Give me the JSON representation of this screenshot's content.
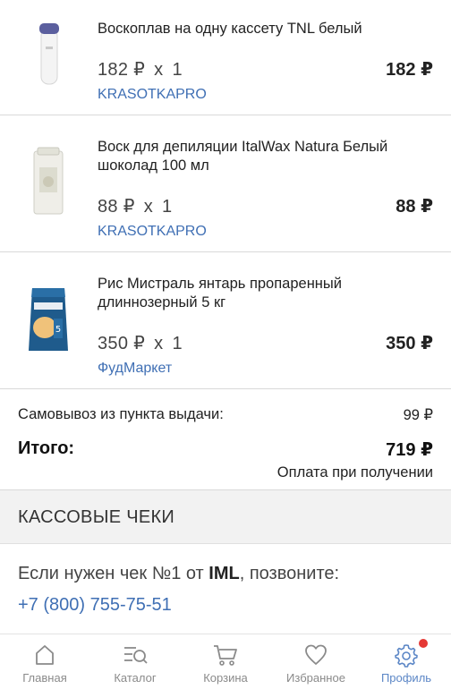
{
  "items": [
    {
      "title": "Воскоплав на одну кассету TNL белый",
      "unit_price": "182 ₽",
      "multiplier": "x",
      "quantity": "1",
      "total": "182 ₽",
      "seller": "KRASOTKAPRO"
    },
    {
      "title": "Воск для депиляции ItalWax Natura Белый шоколад 100 мл",
      "unit_price": "88 ₽",
      "multiplier": "x",
      "quantity": "1",
      "total": "88 ₽",
      "seller": "KRASOTKAPRO"
    },
    {
      "title": "Рис Мистраль янтарь пропаренный длиннозерный 5 кг",
      "unit_price": "350 ₽",
      "multiplier": "x",
      "quantity": "1",
      "total": "350 ₽",
      "seller": "ФудМаркет"
    }
  ],
  "summary": {
    "pickup_label": "Самовывоз из пункта выдачи:",
    "pickup_price": "99 ₽",
    "total_label": "Итого:",
    "total_price": "719 ₽",
    "payment_note": "Оплата при получении"
  },
  "receipts": {
    "header": "КАССОВЫЕ ЧЕКИ",
    "info_prefix": "Если нужен чек №1 от ",
    "info_company": "IML",
    "info_suffix": ", позвоните:",
    "phone": "+7 (800) 755-75-51"
  },
  "nav": {
    "items": [
      {
        "label": "Главная",
        "icon": "home-icon"
      },
      {
        "label": "Каталог",
        "icon": "catalog-search-icon"
      },
      {
        "label": "Корзина",
        "icon": "cart-icon"
      },
      {
        "label": "Избранное",
        "icon": "heart-icon"
      },
      {
        "label": "Профиль",
        "icon": "gear-icon"
      }
    ],
    "active_index": 4,
    "profile_has_notification": true
  },
  "colors": {
    "link": "#3f6fb4",
    "active_nav": "#5b86c6",
    "badge": "#e53935",
    "section_bg": "#f2f2f2"
  }
}
